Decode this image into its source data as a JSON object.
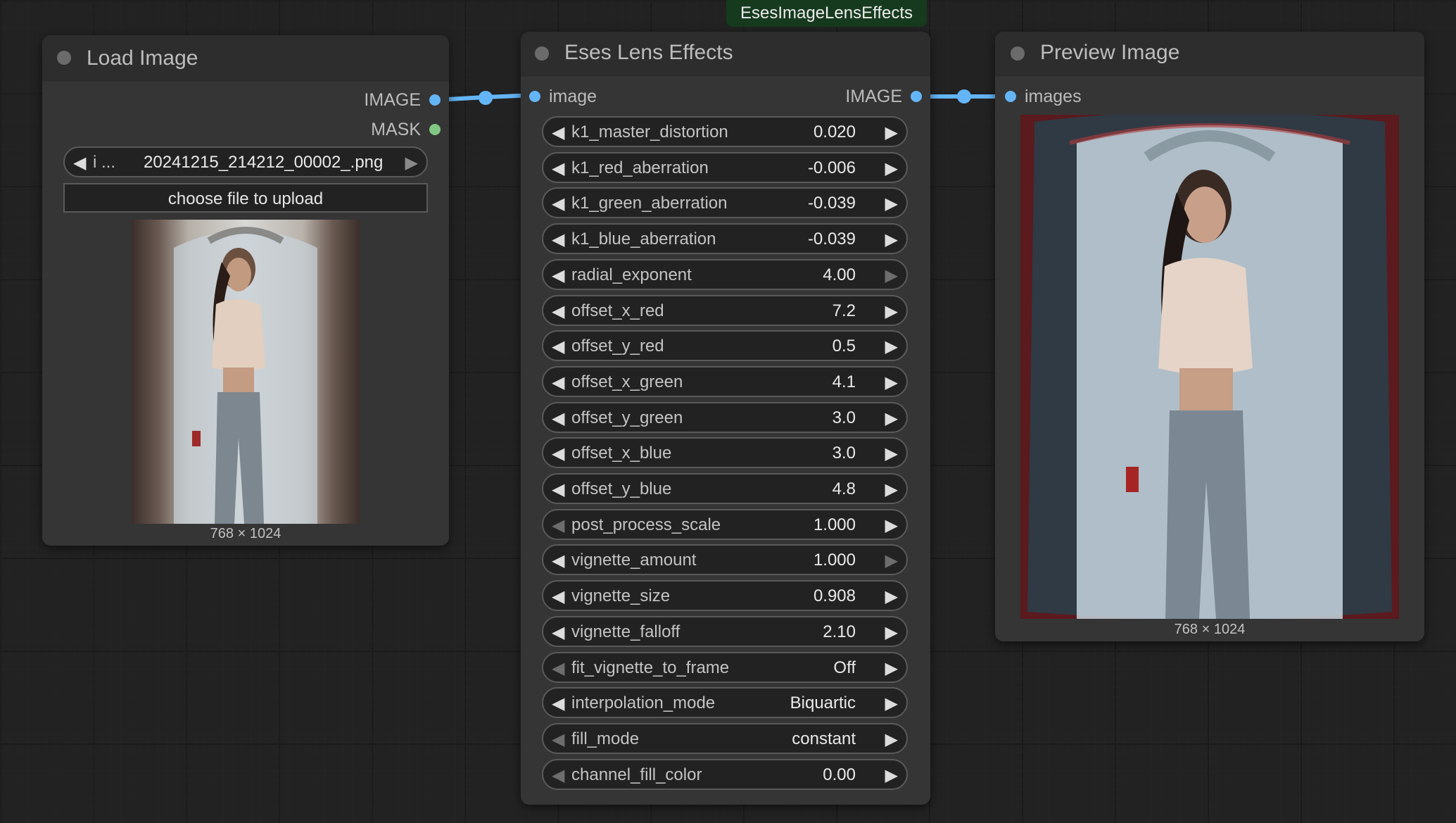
{
  "badge": {
    "label": "EsesImageLensEffects"
  },
  "load_node": {
    "title": "Load Image",
    "outputs": [
      {
        "label": "IMAGE",
        "color": "#64b5f6"
      },
      {
        "label": "MASK",
        "color": "#81c784"
      }
    ],
    "file_combo": {
      "prefix": "i ...",
      "value": "20241215_214212_00002_.png"
    },
    "upload_label": "choose file to upload",
    "image_caption": "768 × 1024"
  },
  "lens_node": {
    "title": "Eses Lens Effects",
    "input_label": "image",
    "output_label": "IMAGE",
    "widgets": [
      {
        "name": "k1_master_distortion",
        "value": "0.020",
        "left_dim": false,
        "right_dim": false
      },
      {
        "name": "k1_red_aberration",
        "value": "-0.006",
        "left_dim": false,
        "right_dim": false
      },
      {
        "name": "k1_green_aberration",
        "value": "-0.039",
        "left_dim": false,
        "right_dim": false
      },
      {
        "name": "k1_blue_aberration",
        "value": "-0.039",
        "left_dim": false,
        "right_dim": false
      },
      {
        "name": "radial_exponent",
        "value": "4.00",
        "left_dim": false,
        "right_dim": true
      },
      {
        "name": "offset_x_red",
        "value": "7.2",
        "left_dim": false,
        "right_dim": false
      },
      {
        "name": "offset_y_red",
        "value": "0.5",
        "left_dim": false,
        "right_dim": false
      },
      {
        "name": "offset_x_green",
        "value": "4.1",
        "left_dim": false,
        "right_dim": false
      },
      {
        "name": "offset_y_green",
        "value": "3.0",
        "left_dim": false,
        "right_dim": false
      },
      {
        "name": "offset_x_blue",
        "value": "3.0",
        "left_dim": false,
        "right_dim": false
      },
      {
        "name": "offset_y_blue",
        "value": "4.8",
        "left_dim": false,
        "right_dim": false
      },
      {
        "name": "post_process_scale",
        "value": "1.000",
        "left_dim": true,
        "right_dim": false
      },
      {
        "name": "vignette_amount",
        "value": "1.000",
        "left_dim": false,
        "right_dim": true
      },
      {
        "name": "vignette_size",
        "value": "0.908",
        "left_dim": false,
        "right_dim": false
      },
      {
        "name": "vignette_falloff",
        "value": "2.10",
        "left_dim": false,
        "right_dim": false
      },
      {
        "name": "fit_vignette_to_frame",
        "value": "Off",
        "left_dim": true,
        "right_dim": false
      },
      {
        "name": "interpolation_mode",
        "value": "Biquartic",
        "left_dim": false,
        "right_dim": false
      },
      {
        "name": "fill_mode",
        "value": "constant",
        "left_dim": true,
        "right_dim": false
      },
      {
        "name": "channel_fill_color",
        "value": "0.00",
        "left_dim": true,
        "right_dim": false
      }
    ]
  },
  "preview_node": {
    "title": "Preview Image",
    "input_label": "images",
    "image_caption": "768 × 1024"
  },
  "colors": {
    "image_link": "#64b5f6",
    "mask_slot": "#81c784",
    "badge_bg": "#163a1e"
  }
}
